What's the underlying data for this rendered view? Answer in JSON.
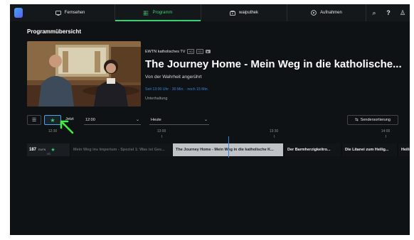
{
  "nav": {
    "items": [
      {
        "label": "Fernsehen",
        "icon": "tv-icon"
      },
      {
        "label": "Programm",
        "icon": "program-guide-icon",
        "active": true
      },
      {
        "label": "waiputhek",
        "icon": "library-icon"
      },
      {
        "label": "Aufnahmen",
        "icon": "record-icon"
      }
    ],
    "search_symbol": "⌕",
    "help_symbol": "?",
    "profile_symbol": "♙"
  },
  "page": {
    "title": "Programmübersicht"
  },
  "hero": {
    "channel": "EWTN katholisches TV",
    "badges": [
      "HD",
      "SD",
      "▶"
    ],
    "title": "The Journey Home - Mein Weg in die katholische...",
    "subtitle": "Von der Wahrheit angerührt",
    "time": "Seit 13:00 Uhr · 30 Min. · noch 15 Min.",
    "genre": "Unterhaltung"
  },
  "toolbar": {
    "list_symbol": "☰",
    "fav_symbol": "★",
    "jetzt_label": "Jetzt",
    "time_select": "12:00",
    "day_select": "Heute",
    "sort_label": "Sendersortierung",
    "sort_symbol": "⇆"
  },
  "timeline": {
    "ticks": [
      "12:30",
      "13:00",
      "13:30",
      "14:00"
    ]
  },
  "epg": {
    "channel_number": "187",
    "channel_logo": "EWTN",
    "channel_sub": "HD",
    "programs": [
      "Mein Weg ins Imperium - Spezial 1: Was ist Ges...",
      "The Journey Home - Mein Weg in die katholische K...",
      "Der Barmherzigkeitro...",
      "Die Litanei zum Heilig...",
      "Heilige M"
    ]
  },
  "colors": {
    "accent_green": "#2ed573",
    "accent_blue": "#2e86de",
    "background": "#0f1214"
  }
}
